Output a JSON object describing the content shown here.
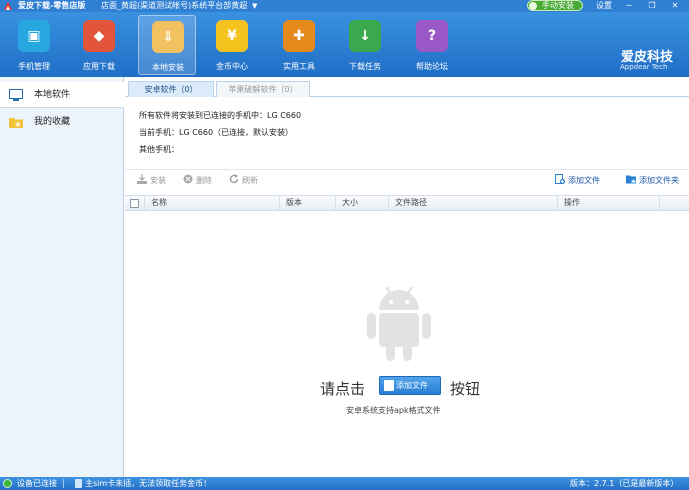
{
  "titlebar": {
    "app_title": "爱皮下载-零售店版",
    "shop": "店面_黄超(渠道测试帐号)系统平台部黄超",
    "caret": "▼",
    "manual_install": "手动安装",
    "settings": "设置",
    "minimize": "─",
    "restore": "❐",
    "close": "✕"
  },
  "toolbar": {
    "items": [
      {
        "label": "手机管理",
        "icon": "phone-manage-icon",
        "color": "#26a7e0",
        "symbol": "▣"
      },
      {
        "label": "应用下载",
        "icon": "app-download-icon",
        "color": "#e2553a",
        "symbol": "◆"
      },
      {
        "label": "本地安装",
        "icon": "local-install-icon",
        "color": "#f1c25f",
        "symbol": "⇓"
      },
      {
        "label": "金币中心",
        "icon": "coin-center-icon",
        "color": "#f3c21d",
        "symbol": "¥"
      },
      {
        "label": "实用工具",
        "icon": "tools-icon",
        "color": "#e48a1d",
        "symbol": "✚"
      },
      {
        "label": "下载任务",
        "icon": "download-task-icon",
        "color": "#3aa94d",
        "symbol": "↓"
      },
      {
        "label": "帮助论坛",
        "icon": "help-forum-icon",
        "color": "#9b59c7",
        "symbol": "?"
      }
    ],
    "active_index": 2,
    "brand": "爱皮科技",
    "brand_sub": "Appdear Tech"
  },
  "sidebar": {
    "items": [
      {
        "label": "本地软件",
        "icon": "local-software-icon"
      },
      {
        "label": "我的收藏",
        "icon": "favorites-folder-icon"
      }
    ]
  },
  "tabs": [
    {
      "label": "安卓软件（0）"
    },
    {
      "label": "苹果破解软件（0）"
    }
  ],
  "info": {
    "line1": "所有软件将安装到已连接的手机中：LG C660",
    "line2": "当前手机：LG C660（已连接，默认安装）",
    "line3": "其他手机："
  },
  "actions": {
    "install": "安装",
    "delete": "删除",
    "refresh": "刷新",
    "add_file": "添加文件",
    "add_folder": "添加文件夹"
  },
  "table": {
    "columns": [
      "名称",
      "版本",
      "大小",
      "文件路径",
      "操作"
    ]
  },
  "empty": {
    "before": "请点击",
    "button": "添加文件",
    "after": "按钮",
    "sub": "安卓系统支持apk格式文件"
  },
  "status": {
    "connected": "设备已连接",
    "sim": "主sim卡未插，无法领取任务金币！",
    "version": "版本：2.7.1（已是最新版本）"
  }
}
